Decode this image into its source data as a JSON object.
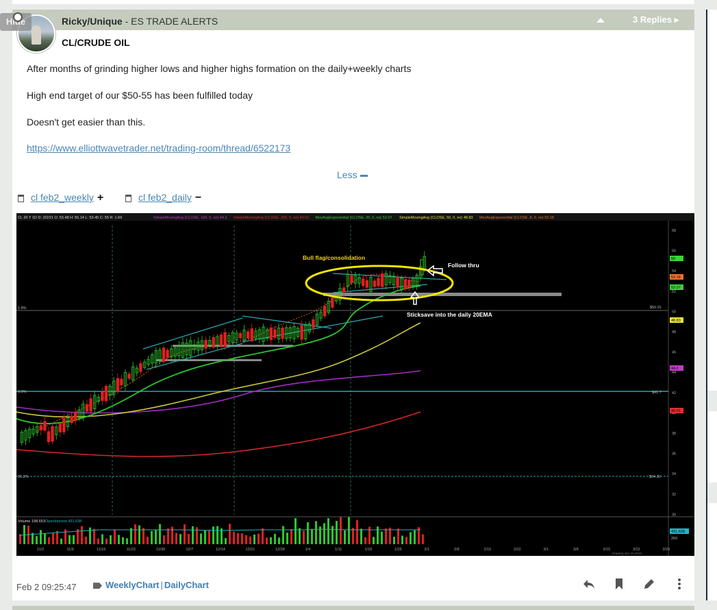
{
  "post": {
    "author": "Ricky/Unique",
    "room": " - ES TRADE ALERTS",
    "replies": "3 Replies",
    "hide_label": "Hide",
    "title": "CL/CRUDE OIL",
    "paragraphs": [
      "After months of grinding higher lows and higher highs formation on the daily+weekly charts",
      "High end target of our $50-55 has been fulfilled today",
      "Doesn't get easier than this."
    ],
    "link": "https://www.elliottwavetrader.net/trading-room/thread/6522173",
    "less_label": "Less"
  },
  "attachments": [
    {
      "name": "cl feb2_weekly",
      "sign": "+"
    },
    {
      "name": "cl feb2_daily",
      "sign": "−"
    }
  ],
  "chart": {
    "header": "CL 20 Y 1D  D: 2/2/21  O: 53.48  H: 55.14  L: 53.45  C: 55  R: 1.69",
    "indicators": [
      {
        "text": "SimpleMovingAvg (CLOSE, 100, 0, no)",
        "value": "44.2",
        "color": "#c23ac8"
      },
      {
        "text": "SimpleMovingAvg (CLOSE, 200, 0, no)",
        "value": "40.01",
        "color": "#e03030"
      },
      {
        "text": "MovAvgExponential (CLOSE, 20, 0, no)",
        "value": "52.07",
        "color": "#3bd13b"
      },
      {
        "text": "SimpleMovingAvg (CLOSE, 50, 0, no)",
        "value": "48.83",
        "color": "#e6e63a"
      },
      {
        "text": "MovAvgExponential (CLOSE, 8, 0, no)",
        "value": "53.18",
        "color": "#e8772e"
      }
    ],
    "annotations": {
      "bull_flag": "Bull flag/consolidation",
      "follow_thru": "Follow thru",
      "sticksave": "Sticksave into the daily 20EMA"
    },
    "y_ticks": [
      "58",
      "56",
      "54",
      "52",
      "50",
      "48",
      "46",
      "44",
      "42",
      "40",
      "38",
      "36",
      "34",
      "32",
      "30"
    ],
    "price_tags": [
      {
        "value": "55",
        "color": "#3bd13b"
      },
      {
        "value": "53.18",
        "color": "#e8772e"
      },
      {
        "value": "52.07",
        "color": "#3bd13b"
      },
      {
        "value": "48.83",
        "color": "#e6e63a"
      },
      {
        "value": "44.2",
        "color": "#c23ac8"
      },
      {
        "value": "40.01",
        "color": "#e03030"
      }
    ],
    "level_labels": {
      "l1": "$50.01",
      "l2": "$41.7",
      "l3": "$34.30"
    },
    "left_labels": {
      "a": "1.8%",
      "b": "0.0%",
      "c": "36.2%"
    },
    "volume_header": "Volume  198,653",
    "oi_label": "OpenInterest  431,638",
    "oi_tag": "431,638",
    "vol_tick": "250",
    "x_ticks": [
      "11/2",
      "11/9",
      "11/16",
      "11/23",
      "11/30",
      "12/7",
      "12/14",
      "12/21",
      "12/28",
      "1/4",
      "1/11",
      "1/18",
      "1/25",
      "2/1",
      "2/8",
      "2/15",
      "2/22",
      "3/1",
      "3/8",
      "3/15",
      "3/22",
      "3/29"
    ],
    "watermark": "Drawing size CL2019"
  },
  "footer": {
    "date": "Feb 2 09:25:47",
    "tags": [
      "WeeklyChart",
      "DailyChart"
    ]
  }
}
